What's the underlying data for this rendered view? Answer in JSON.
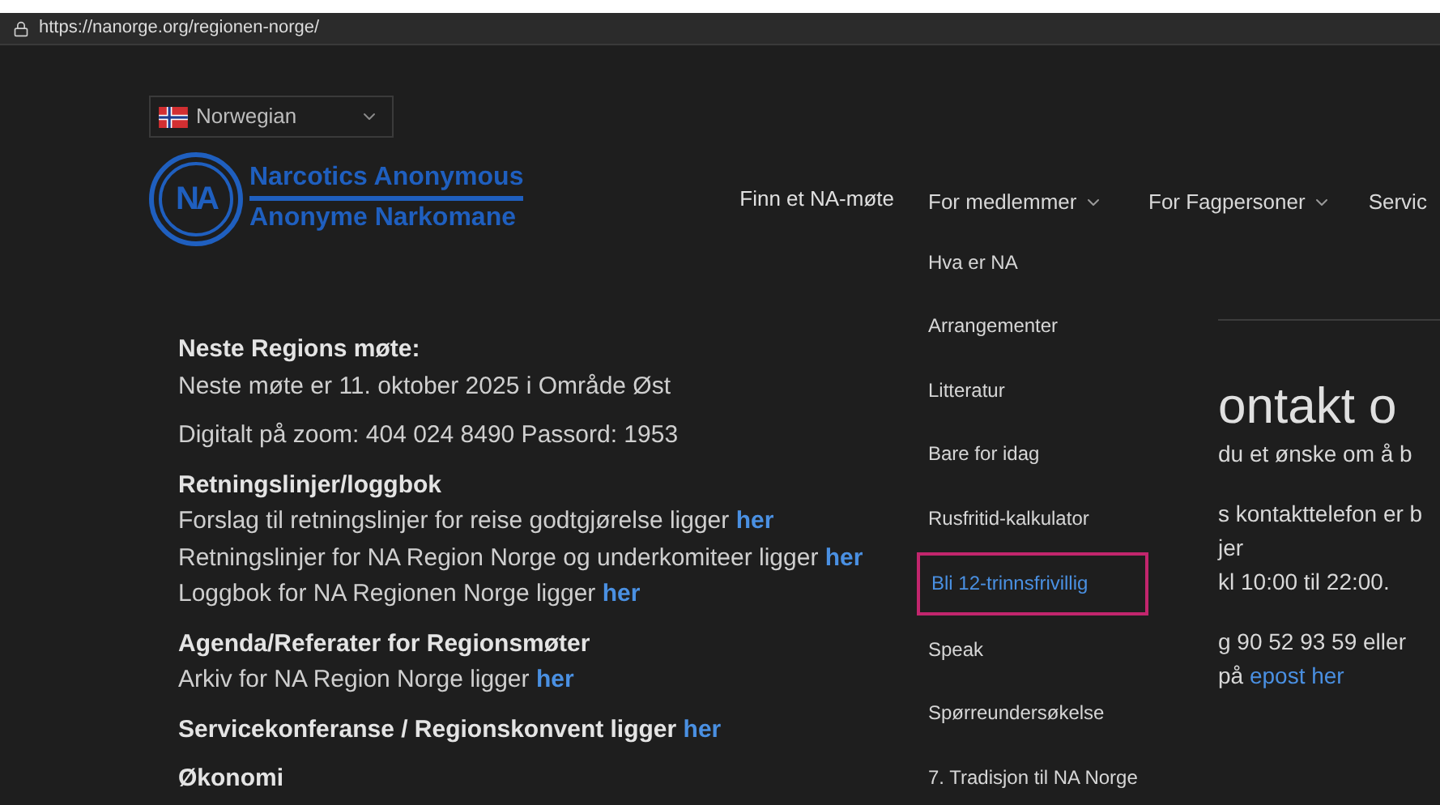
{
  "address_bar": {
    "url": "https://nanorge.org/regionen-norge/"
  },
  "language_selector": {
    "value": "Norwegian"
  },
  "logo": {
    "mark": "NA",
    "line_1": "Narcotics Anonymous",
    "line_2": "Anonyme Narkomane"
  },
  "nav": [
    {
      "label": "Finn et NA-møte",
      "dropdown": false
    },
    {
      "label": "For medlemmer",
      "dropdown": true
    },
    {
      "label": "For Fagpersoner",
      "dropdown": true
    },
    {
      "label": "Servic",
      "dropdown": false
    }
  ],
  "dropdown": [
    {
      "label": "Hva er NA",
      "selected": false,
      "highlighted": false
    },
    {
      "label": "Arrangementer",
      "selected": false,
      "highlighted": false
    },
    {
      "label": "Litteratur",
      "selected": false,
      "highlighted": false
    },
    {
      "label": "Bare for idag",
      "selected": false,
      "highlighted": false
    },
    {
      "label": "Rusfritid-kalkulator",
      "selected": false,
      "highlighted": false
    },
    {
      "label": "Bli 12-trinnsfrivillig",
      "selected": true,
      "highlighted": true
    },
    {
      "label": "Speak",
      "selected": false,
      "highlighted": false
    },
    {
      "label": "Spørreundersøkelse",
      "selected": false,
      "highlighted": false
    },
    {
      "label": "7. Tradisjon til NA Norge",
      "selected": false,
      "highlighted": false
    }
  ],
  "content_groups": [
    [
      {
        "kind": "heading",
        "text": "Neste Regions møte:"
      },
      {
        "kind": "text",
        "text": "Neste møte er 11. oktober 2025 i Område Øst"
      }
    ],
    [
      {
        "kind": "text",
        "text": "Digitalt på zoom: 404 024 8490 Passord: 1953"
      }
    ],
    [
      {
        "kind": "heading",
        "text": "Retningslinjer/loggbok"
      },
      {
        "kind": "text",
        "text": "Forslag til retningslinjer for reise godtgjørelse ligger",
        "link": "her"
      },
      {
        "kind": "text",
        "text": "Retningslinjer for NA Region Norge og underkomiteer ligger",
        "link": "her"
      },
      {
        "kind": "text",
        "text": "Loggbok for NA Regionen Norge ligger",
        "link": "her"
      }
    ],
    [
      {
        "kind": "heading",
        "text": "Agenda/Referater for Regionsmøter"
      },
      {
        "kind": "text",
        "text": "Arkiv for NA Region Norge ligger",
        "link": "her"
      }
    ],
    [
      {
        "kind": "heading",
        "text": "Servicekonferanse / Regionskonvent ligger",
        "link": "her"
      }
    ],
    [
      {
        "kind": "heading",
        "text": "Økonomi"
      }
    ]
  ],
  "contact": {
    "title": "ontakt o",
    "paragraphs": [
      [
        {
          "text": "du et ønske om å b"
        }
      ],
      [
        {
          "text": "s kontakttelefon er b"
        },
        {
          "text": "jer"
        },
        {
          "text": "kl 10:00 til 22:00."
        }
      ],
      [
        {
          "text": "g 90 52 93 59 eller"
        },
        {
          "text": "på",
          "link": "epost her"
        }
      ]
    ]
  }
}
